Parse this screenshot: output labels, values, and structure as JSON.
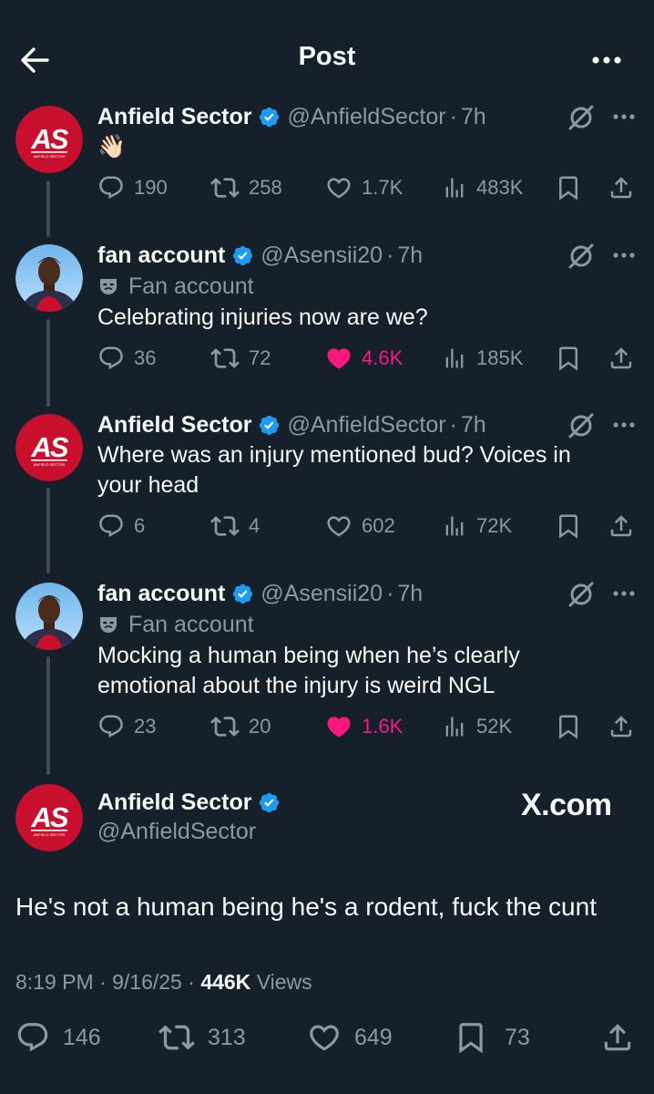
{
  "header": {
    "title": "Post"
  },
  "replies": [
    {
      "name": "Anfield Sector",
      "handle": "@AnfieldSector",
      "time": "7h",
      "text": "👋🏻",
      "stats": {
        "replies": "190",
        "reposts": "258",
        "likes": "1.7K",
        "views": "483K"
      },
      "liked": false
    },
    {
      "name": "fan account",
      "handle": "@Asensii20",
      "time": "7h",
      "label": "Fan account",
      "text": "Celebrating injuries now are we?",
      "stats": {
        "replies": "36",
        "reposts": "72",
        "likes": "4.6K",
        "views": "185K"
      },
      "liked": true
    },
    {
      "name": "Anfield Sector",
      "handle": "@AnfieldSector",
      "time": "7h",
      "text_lines": [
        "Where was an injury mentioned bud? Voices in",
        "your head"
      ],
      "stats": {
        "replies": "6",
        "reposts": "4",
        "likes": "602",
        "views": "72K"
      },
      "liked": false
    },
    {
      "name": "fan account",
      "handle": "@Asensii20",
      "time": "7h",
      "label": "Fan account",
      "text_lines": [
        "Mocking a human being when he’s clearly",
        "emotional about the injury is weird NGL"
      ],
      "stats": {
        "replies": "23",
        "reposts": "20",
        "likes": "1.6K",
        "views": "52K"
      },
      "liked": true
    }
  ],
  "main": {
    "name": "Anfield Sector",
    "handle": "@AnfieldSector",
    "watermark": "X.com",
    "text": "He's not a human being he's a rodent, fuck the cunt",
    "time": "8:19 PM",
    "date": "9/16/25",
    "views": "446K",
    "views_label": "Views",
    "stats": {
      "replies": "146",
      "reposts": "313",
      "likes": "649",
      "bookmarks": "73"
    }
  },
  "colors": {
    "background": "#15202b",
    "text": "#f7f9f9",
    "secondary": "#8b98a5",
    "verified": "#1d9bf0",
    "like": "#f91880",
    "thread_line": "#3e4a57"
  },
  "icons": [
    "back-arrow-icon",
    "more-icon",
    "verified-icon",
    "grok-icon",
    "reply-icon",
    "repost-icon",
    "like-icon",
    "views-icon",
    "bookmark-icon",
    "share-icon",
    "mask-icon"
  ]
}
